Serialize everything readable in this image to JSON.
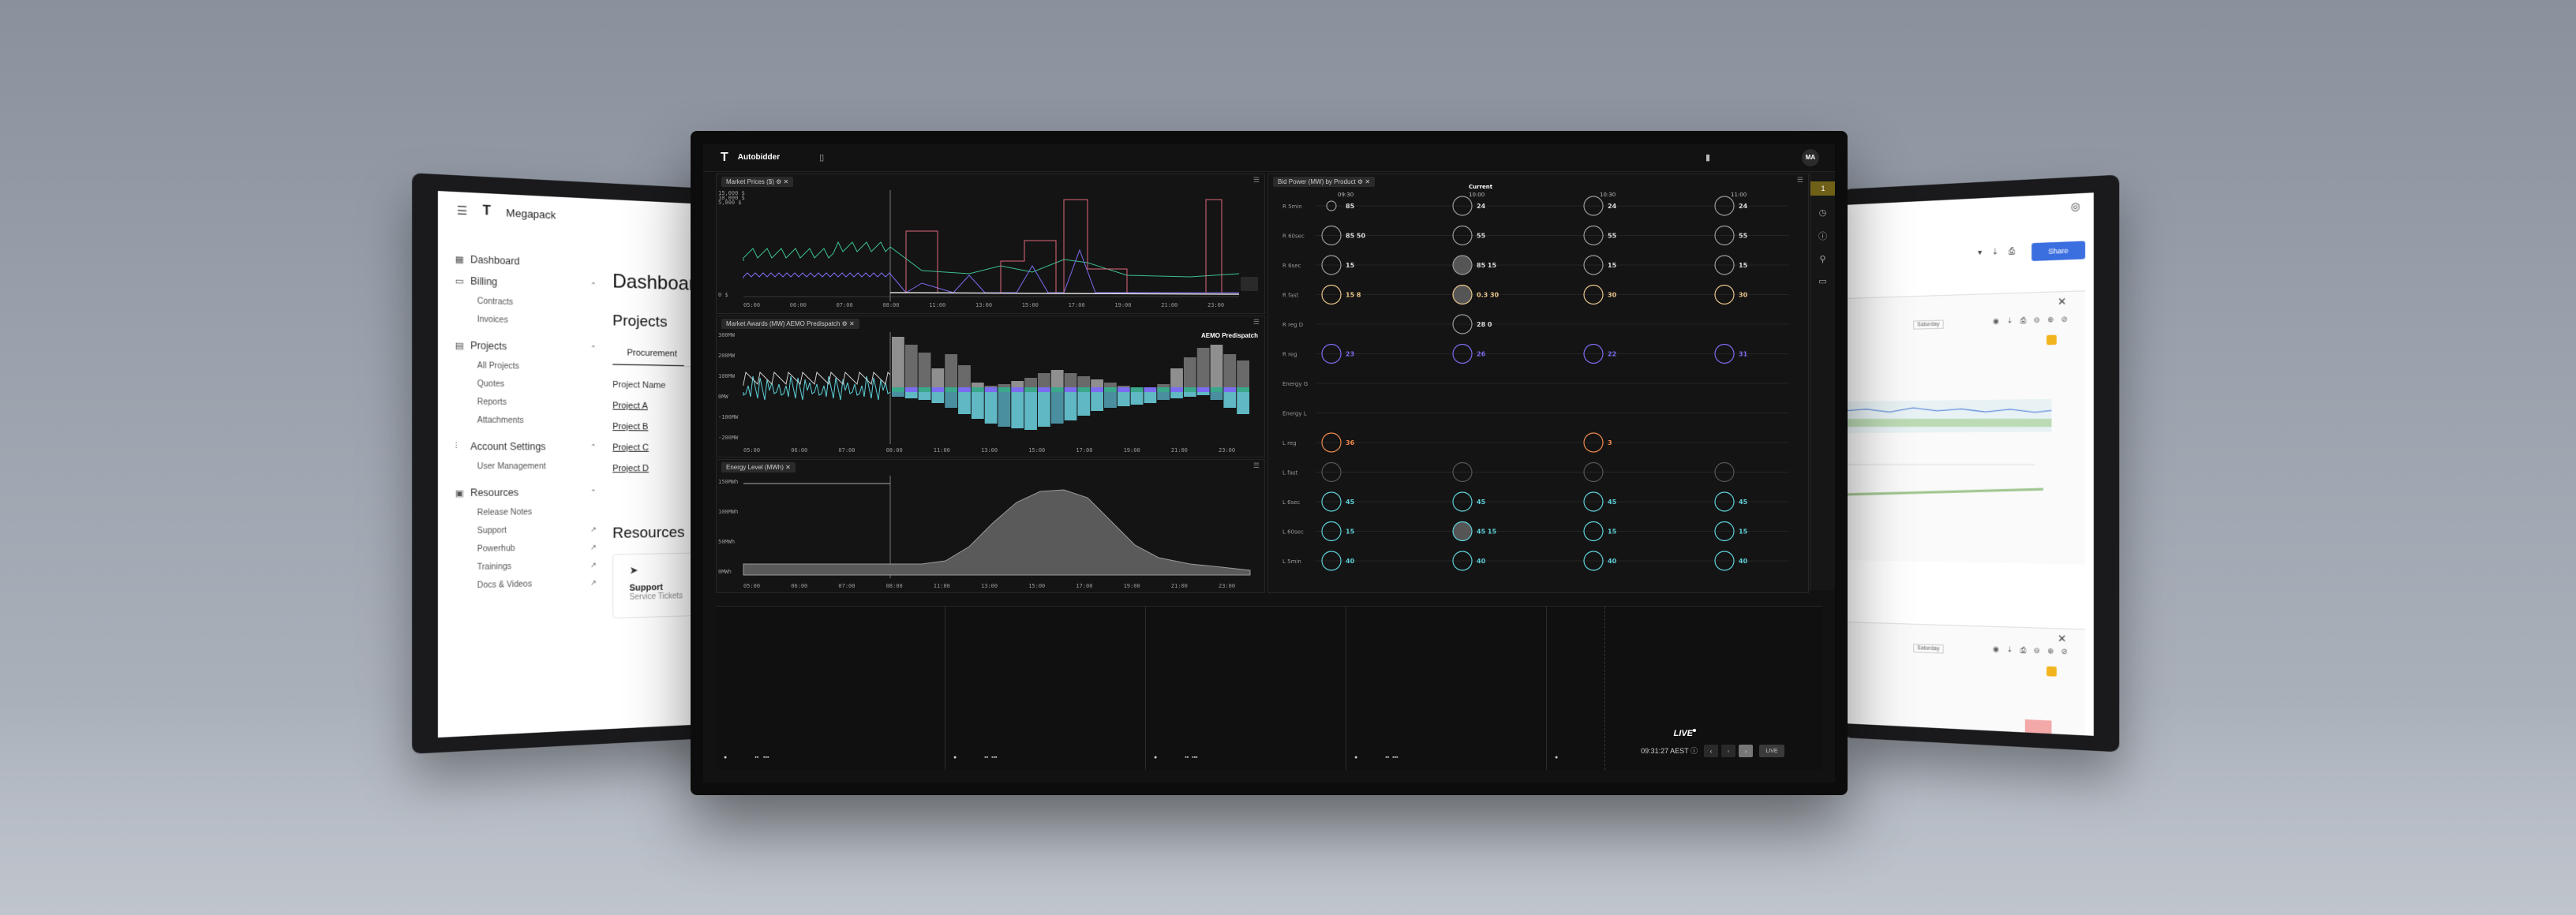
{
  "left": {
    "brand": "Megapack",
    "nav": {
      "dashboard": "Dashboard",
      "billing": "Billing",
      "billing_items": [
        "Contracts",
        "Invoices"
      ],
      "projects": "Projects",
      "projects_items": [
        "All Projects",
        "Quotes",
        "Reports",
        "Attachments"
      ],
      "account": "Account Settings",
      "account_items": [
        "User Management"
      ],
      "resources": "Resources",
      "resources_items": [
        "Release Notes",
        "Support",
        "Powerhub",
        "Trainings",
        "Docs & Videos"
      ]
    },
    "main": {
      "title": "Dashboard",
      "projects_title": "Projects",
      "tab": "Procurement",
      "column": "Project Name",
      "rows": [
        "Project A",
        "Project B",
        "Project C",
        "Project D"
      ],
      "resources_title": "Resources",
      "card_title": "Support",
      "card_sub": "Service Tickets"
    }
  },
  "center": {
    "app": "Autobidder",
    "avatar": "MA",
    "panels": {
      "market_prices": "Market Prices ($)",
      "market_awards": "Market Awards (MW) AEMO Predispatch",
      "awards_label": "AEMO Predispatch",
      "energy_level": "Energy Level (MWh)",
      "bid_power": "Bid Power (MW) by Product"
    },
    "price_yticks": [
      "15,000 $",
      "10,000 $",
      "5,000 $",
      "0 $"
    ],
    "awards_yticks": [
      "300MW",
      "200MW",
      "100MW",
      "0MW",
      "-100MW",
      "-200MW"
    ],
    "energy_yticks": [
      "150MWh",
      "100MWh",
      "50MWh",
      "0MWh"
    ],
    "time_ticks": [
      "05:00",
      "06:00",
      "07:00",
      "08:00",
      "11:00",
      "13:00",
      "15:00",
      "17:00",
      "19:00",
      "21:00",
      "23:00"
    ],
    "bid": {
      "rows": [
        "R 5min",
        "R 60sec",
        "R 6sec",
        "R fast",
        "R reg D",
        "R reg",
        "Energy G",
        "Energy L",
        "L reg",
        "L fast",
        "L 6sec",
        "L 60sec",
        "L 5min"
      ],
      "col_times": [
        "09:30",
        "10:00",
        "10:30",
        "11:00"
      ],
      "current_label": "Current",
      "values": [
        [
          "85",
          "24",
          "24",
          "24"
        ],
        [
          "85 50",
          "55",
          "55",
          "55"
        ],
        [
          "15",
          "85 15",
          "15",
          "15"
        ],
        [
          "15 8",
          "0.3 30",
          "30",
          "30"
        ],
        [
          "",
          "28 0",
          "",
          ""
        ],
        [
          "23",
          "26",
          "22",
          "31"
        ],
        [
          "",
          "",
          "",
          ""
        ],
        [
          "",
          "",
          "",
          ""
        ],
        [
          "36",
          "",
          "3",
          ""
        ],
        [
          "",
          "",
          "",
          ""
        ],
        [
          "45",
          "45",
          "45",
          "45"
        ],
        [
          "15",
          "45 15",
          "15",
          "15"
        ],
        [
          "40",
          "40",
          "40",
          "40"
        ]
      ]
    },
    "live": "LIVE",
    "clock": "09:31:27 AEST",
    "live_button": "LIVE"
  },
  "right": {
    "share": "Share",
    "timely": "Saturday"
  },
  "colors": {
    "accent_blue": "#3b6fe0",
    "rail_active": "#6f6018",
    "cyan": "#5ed0d9",
    "purple": "#7b6cf0",
    "orange": "#f08a4b",
    "green": "#3cc08c"
  }
}
